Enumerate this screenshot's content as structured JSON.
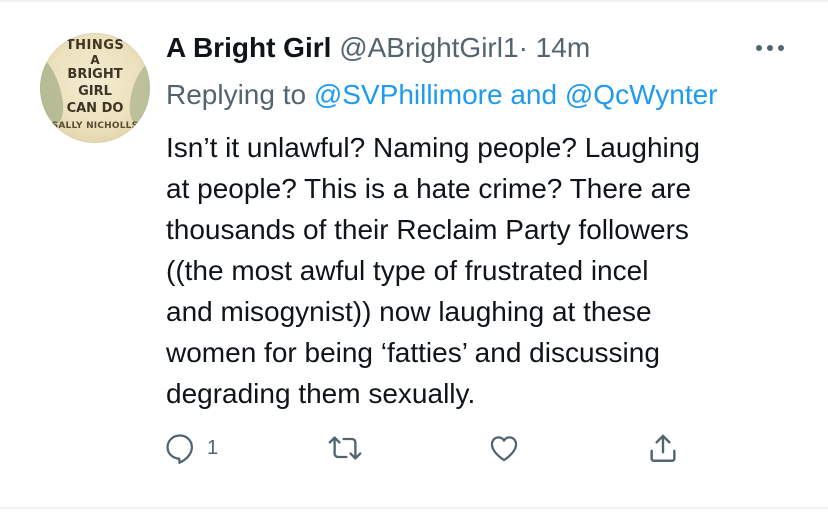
{
  "tweet": {
    "author": {
      "display_name": "A Bright Girl",
      "handle": "@ABrightGirl1",
      "avatar": {
        "cover_lines": [
          "THINGS",
          "A",
          "BRIGHT",
          "GIRL",
          "CAN DO",
          "SALLY NICHOLLS"
        ]
      }
    },
    "separator": "·",
    "time": "14m",
    "replying": {
      "prefix": "Replying to",
      "mention_1": "@SVPhillimore",
      "conjunction": "and",
      "mention_2": "@QcWynter"
    },
    "text_lines": [
      "Isn’t it unlawful? Naming people? Laughing",
      "at people? This is a hate crime? There are",
      "thousands of their Reclaim Party followers",
      "((the most awful type of frustrated incel",
      "and misogynist)) now laughing at these",
      "women for being ‘fatties’ and discussing",
      "degrading them sexually."
    ],
    "actions": {
      "reply_count": "1",
      "icons": [
        "reply-icon",
        "retweet-icon",
        "like-icon",
        "share-icon"
      ]
    }
  },
  "colors": {
    "text": "#0f1419",
    "secondary": "#536471",
    "link": "#1d9bf0",
    "divider": "#eff3f4"
  }
}
